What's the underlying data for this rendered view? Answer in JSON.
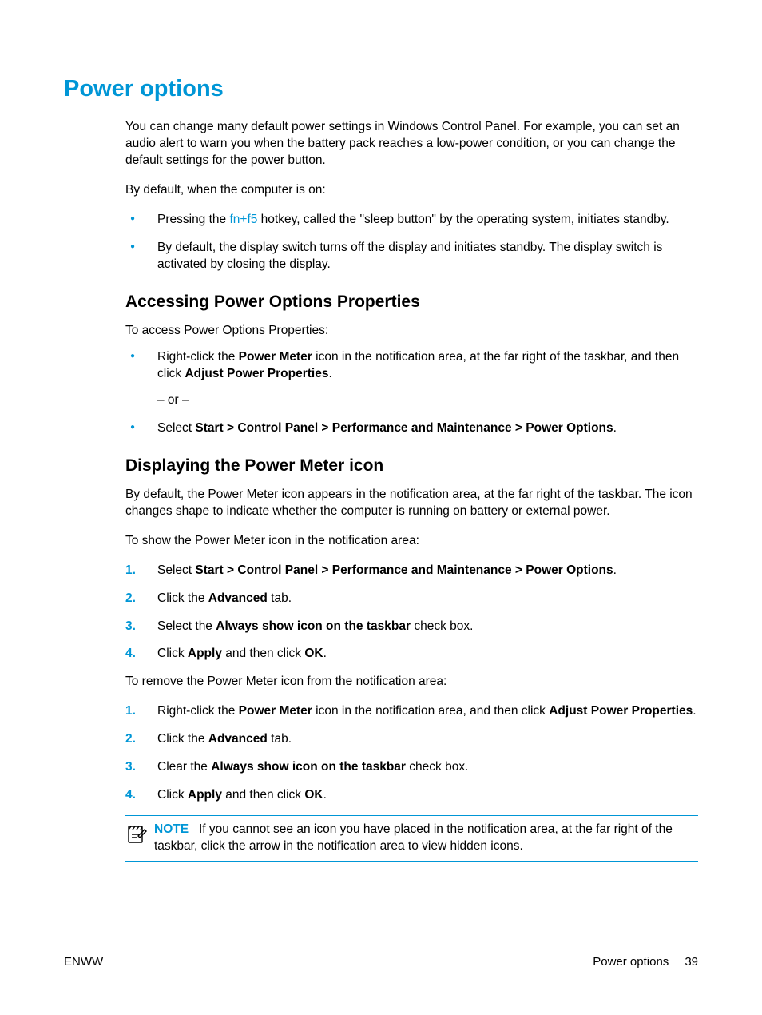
{
  "h1": "Power options",
  "intro_p1": "You can change many default power settings in Windows Control Panel. For example, you can set an audio alert to warn you when the battery pack reaches a low-power condition, or you can change the default settings for the power button.",
  "intro_p2": "By default, when the computer is on:",
  "intro_bullets": {
    "b1_pre": "Pressing the ",
    "b1_link": "fn+f5",
    "b1_post": " hotkey, called the \"sleep button\" by the operating system, initiates standby.",
    "b2": "By default, the display switch turns off the display and initiates standby. The display switch is activated by closing the display."
  },
  "h2a": "Accessing Power Options Properties",
  "access_intro": "To access Power Options Properties:",
  "access_b1_pre": "Right-click the ",
  "access_b1_bold1": "Power Meter",
  "access_b1_mid": " icon in the notification area, at the far right of the taskbar, and then click ",
  "access_b1_bold2": "Adjust Power Properties",
  "access_b1_post": ".",
  "or_text": "– or –",
  "access_b2_pre": "Select ",
  "access_b2_bold": "Start > Control Panel > Performance and Maintenance > Power Options",
  "access_b2_post": ".",
  "h2b": "Displaying the Power Meter icon",
  "disp_p1": "By default, the Power Meter icon appears in the notification area, at the far right of the taskbar. The icon changes shape to indicate whether the computer is running on battery or external power.",
  "disp_p2": "To show the Power Meter icon in the notification area:",
  "show_list": {
    "n1_pre": "Select ",
    "n1_bold": "Start > Control Panel > Performance and Maintenance > Power Options",
    "n1_post": ".",
    "n2_pre": "Click the ",
    "n2_bold": "Advanced",
    "n2_post": " tab.",
    "n3_pre": "Select the ",
    "n3_bold": "Always show icon on the taskbar",
    "n3_post": " check box.",
    "n4_pre": "Click ",
    "n4_bold1": "Apply",
    "n4_mid": " and then click ",
    "n4_bold2": "OK",
    "n4_post": "."
  },
  "disp_p3": "To remove the Power Meter icon from the notification area:",
  "remove_list": {
    "n1_pre": "Right-click the ",
    "n1_bold1": "Power Meter",
    "n1_mid": " icon in the notification area, and then click ",
    "n1_bold2": "Adjust Power Properties",
    "n1_post": ".",
    "n2_pre": "Click the ",
    "n2_bold": "Advanced",
    "n2_post": " tab.",
    "n3_pre": "Clear the ",
    "n3_bold": "Always show icon on the taskbar",
    "n3_post": " check box.",
    "n4_pre": "Click ",
    "n4_bold1": "Apply",
    "n4_mid": " and then click ",
    "n4_bold2": "OK",
    "n4_post": "."
  },
  "note_label": "NOTE",
  "note_text": "If you cannot see an icon you have placed in the notification area, at the far right of the taskbar, click the arrow in the notification area to view hidden icons.",
  "footer_left": "ENWW",
  "footer_section": "Power options",
  "footer_page": "39",
  "nums": {
    "n1": "1.",
    "n2": "2.",
    "n3": "3.",
    "n4": "4."
  }
}
